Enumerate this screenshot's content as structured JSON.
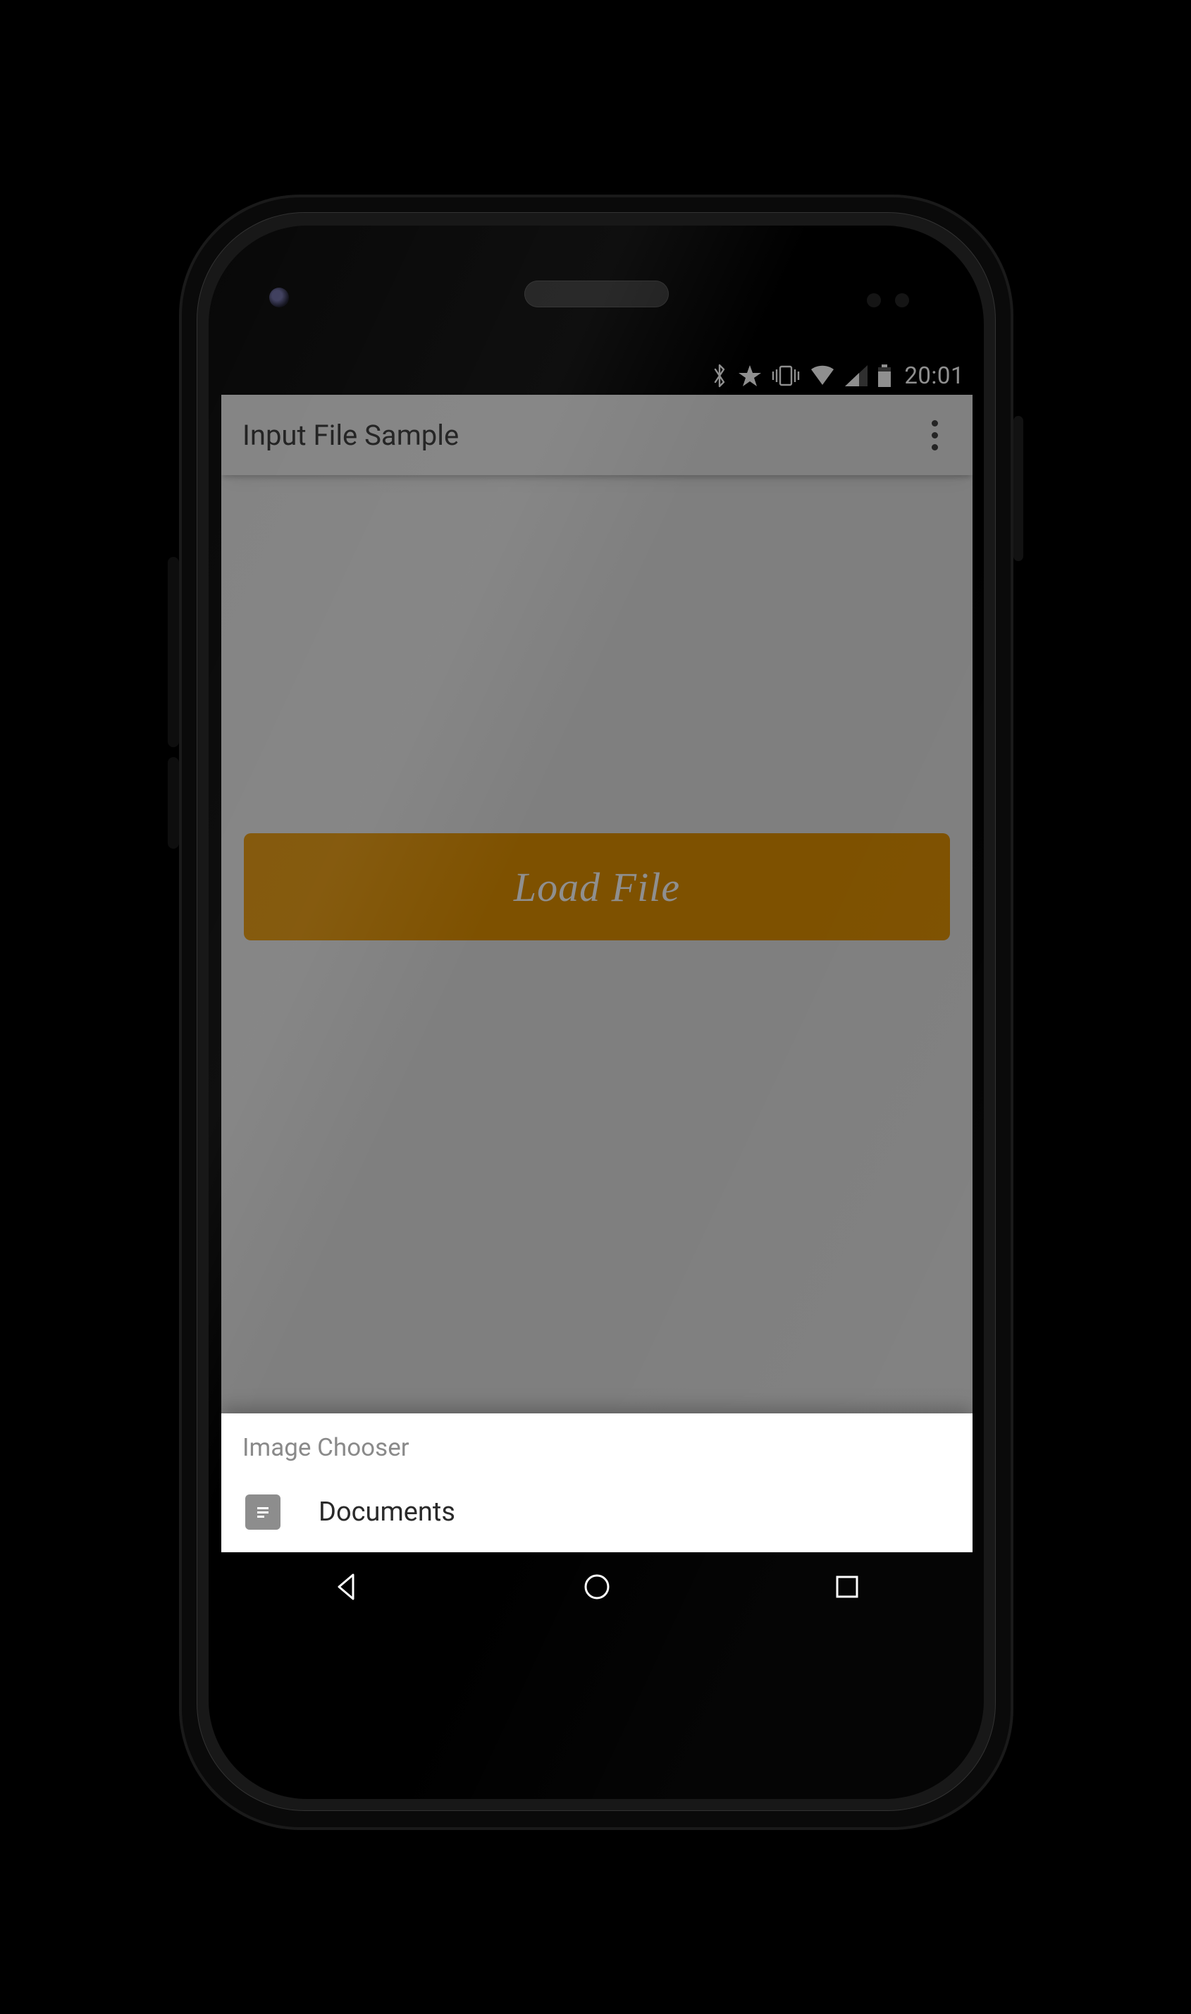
{
  "status": {
    "clock": "20:01",
    "icons": [
      "bluetooth",
      "star",
      "vibrate",
      "wifi",
      "signal",
      "battery"
    ]
  },
  "appbar": {
    "title": "Input File Sample"
  },
  "main": {
    "load_button": "Load File"
  },
  "sheet": {
    "title": "Image Chooser",
    "items": [
      {
        "icon": "document",
        "label": "Documents"
      }
    ]
  }
}
